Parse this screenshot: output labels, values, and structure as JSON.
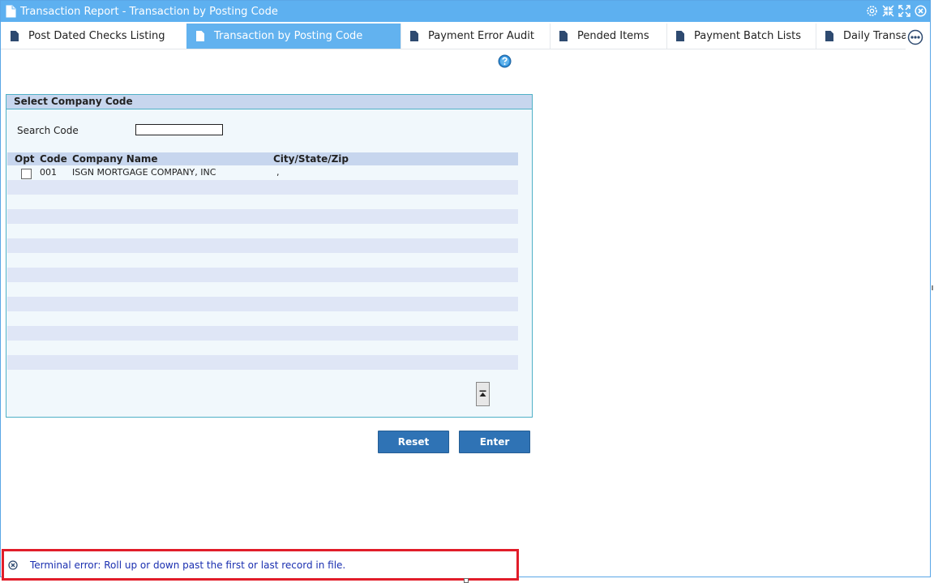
{
  "window": {
    "title": "Transaction Report - Transaction by Posting Code",
    "tools": [
      "gear-icon",
      "compress-icon",
      "expand-icon",
      "close-icon"
    ]
  },
  "tabs": [
    {
      "label": "Post Dated Checks Listing",
      "active": false
    },
    {
      "label": "Transaction by Posting Code",
      "active": true
    },
    {
      "label": "Payment Error Audit",
      "active": false
    },
    {
      "label": "Pended Items",
      "active": false
    },
    {
      "label": "Payment Batch Lists",
      "active": false
    },
    {
      "label": "Daily Transactions",
      "active": false
    }
  ],
  "panel": {
    "header": "Select Company Code",
    "search_label": "Search Code",
    "search_value": "",
    "columns": {
      "opt": "Opt",
      "code": "Code",
      "name": "Company Name",
      "city": "City/State/Zip"
    },
    "rows": [
      {
        "code": "001",
        "name": "ISGN MORTGAGE COMPANY, INC",
        "city": ","
      }
    ]
  },
  "buttons": {
    "reset": "Reset",
    "enter": "Enter"
  },
  "status": {
    "message": "Terminal error: Roll up or down past the first or last record in file."
  },
  "colors": {
    "accent": "#5db0f0",
    "button": "#2f73b5",
    "error_border": "#e11d2a",
    "error_text": "#1a2fb0"
  }
}
